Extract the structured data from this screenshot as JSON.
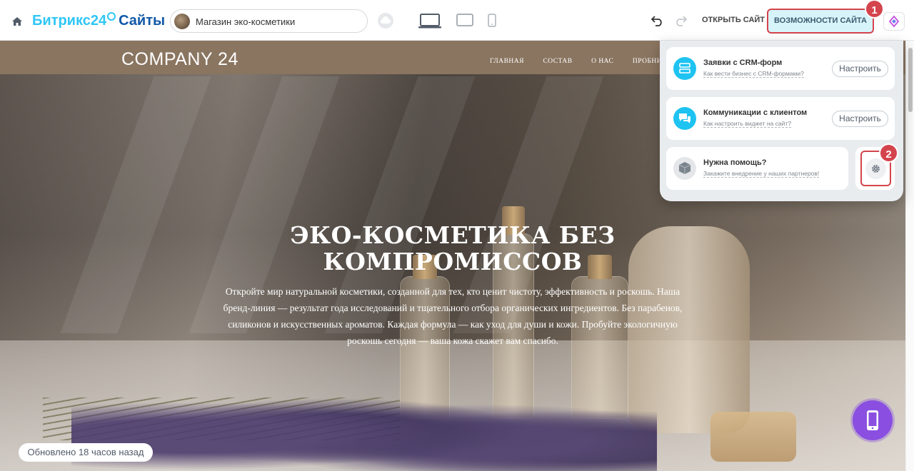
{
  "topbar": {
    "brand_name": "Битрикс24",
    "brand_suffix": "Сайты",
    "site_name": "Магазин эко-косметики",
    "open_site_label": "ОТКРЫТЬ САЙТ",
    "features_label": "ВОЗМОЖНОСТИ САЙТА",
    "step_marker_1": "1",
    "icons": [
      "home-icon",
      "cloud-icon",
      "desktop-view-icon",
      "tablet-view-icon",
      "mobile-view-icon",
      "undo-icon",
      "redo-icon",
      "ai-assistant-icon"
    ]
  },
  "site": {
    "logo": "COMPANY 24",
    "nav": [
      "ГЛАВНАЯ",
      "СОСТАВ",
      "О НАС",
      "ПРОБНИК"
    ],
    "hero_title": "ЭКО-КОСМЕТИКА БЕЗ КОМПРОМИССОВ",
    "hero_text": "Откройте мир натуральной косметики, созданной для тех, кто ценит чистоту, эффективность и роскошь. Наша бренд-линия — результат года исследований и тщательного отбора органических ингредиентов. Без парабенов, силиконов и искусственных ароматов. Каждая формула — как уход для души и кожи. Пробуйте экологичную роскошь сегодня — ваша кожа скажет вам спасибо.",
    "updated_label": "Обновлено 18 часов назад"
  },
  "panel": {
    "crm": {
      "title": "Заявки с CRM-форм",
      "subtitle": "Как вести бизнес с CRM-формами?",
      "button": "Настроить"
    },
    "communications": {
      "title": "Коммуникации с клиентом",
      "subtitle": "Как настроить виджет на сайт?",
      "button": "Настроить"
    },
    "help": {
      "title": "Нужна помощь?",
      "subtitle": "Закажите внедрение у наших партнеров!"
    },
    "step_marker_2": "2"
  },
  "colors": {
    "accent_blue": "#2fc6f6",
    "brand_dark_blue": "#1058a8",
    "highlight_red": "#d4444c",
    "features_bg": "#d8f4fb",
    "site_header": "#8a7560",
    "fab_purple": "#8a4fe0"
  }
}
